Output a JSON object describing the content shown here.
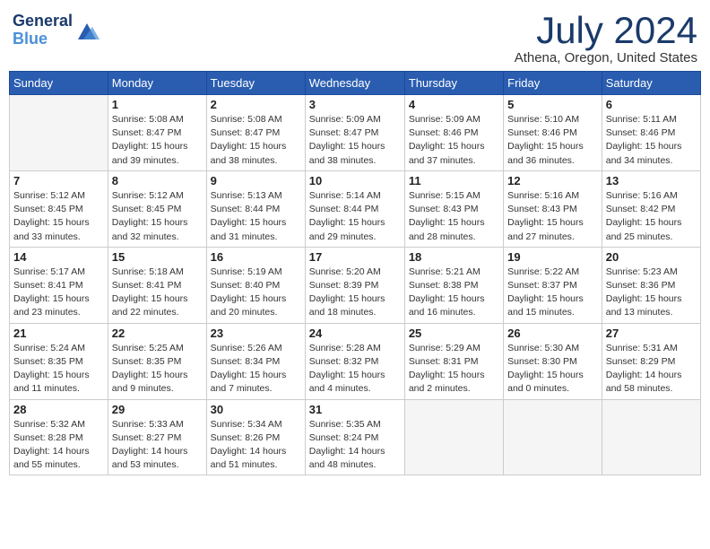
{
  "header": {
    "logo_line1": "General",
    "logo_line2": "Blue",
    "month_title": "July 2024",
    "location": "Athena, Oregon, United States"
  },
  "weekdays": [
    "Sunday",
    "Monday",
    "Tuesday",
    "Wednesday",
    "Thursday",
    "Friday",
    "Saturday"
  ],
  "weeks": [
    [
      {
        "day": "",
        "sunrise": "",
        "sunset": "",
        "daylight": "",
        "empty": true
      },
      {
        "day": "1",
        "sunrise": "5:08 AM",
        "sunset": "8:47 PM",
        "daylight": "15 hours and 39 minutes."
      },
      {
        "day": "2",
        "sunrise": "5:08 AM",
        "sunset": "8:47 PM",
        "daylight": "15 hours and 38 minutes."
      },
      {
        "day": "3",
        "sunrise": "5:09 AM",
        "sunset": "8:47 PM",
        "daylight": "15 hours and 38 minutes."
      },
      {
        "day": "4",
        "sunrise": "5:09 AM",
        "sunset": "8:46 PM",
        "daylight": "15 hours and 37 minutes."
      },
      {
        "day": "5",
        "sunrise": "5:10 AM",
        "sunset": "8:46 PM",
        "daylight": "15 hours and 36 minutes."
      },
      {
        "day": "6",
        "sunrise": "5:11 AM",
        "sunset": "8:46 PM",
        "daylight": "15 hours and 34 minutes."
      }
    ],
    [
      {
        "day": "7",
        "sunrise": "5:12 AM",
        "sunset": "8:45 PM",
        "daylight": "15 hours and 33 minutes."
      },
      {
        "day": "8",
        "sunrise": "5:12 AM",
        "sunset": "8:45 PM",
        "daylight": "15 hours and 32 minutes."
      },
      {
        "day": "9",
        "sunrise": "5:13 AM",
        "sunset": "8:44 PM",
        "daylight": "15 hours and 31 minutes."
      },
      {
        "day": "10",
        "sunrise": "5:14 AM",
        "sunset": "8:44 PM",
        "daylight": "15 hours and 29 minutes."
      },
      {
        "day": "11",
        "sunrise": "5:15 AM",
        "sunset": "8:43 PM",
        "daylight": "15 hours and 28 minutes."
      },
      {
        "day": "12",
        "sunrise": "5:16 AM",
        "sunset": "8:43 PM",
        "daylight": "15 hours and 27 minutes."
      },
      {
        "day": "13",
        "sunrise": "5:16 AM",
        "sunset": "8:42 PM",
        "daylight": "15 hours and 25 minutes."
      }
    ],
    [
      {
        "day": "14",
        "sunrise": "5:17 AM",
        "sunset": "8:41 PM",
        "daylight": "15 hours and 23 minutes."
      },
      {
        "day": "15",
        "sunrise": "5:18 AM",
        "sunset": "8:41 PM",
        "daylight": "15 hours and 22 minutes."
      },
      {
        "day": "16",
        "sunrise": "5:19 AM",
        "sunset": "8:40 PM",
        "daylight": "15 hours and 20 minutes."
      },
      {
        "day": "17",
        "sunrise": "5:20 AM",
        "sunset": "8:39 PM",
        "daylight": "15 hours and 18 minutes."
      },
      {
        "day": "18",
        "sunrise": "5:21 AM",
        "sunset": "8:38 PM",
        "daylight": "15 hours and 16 minutes."
      },
      {
        "day": "19",
        "sunrise": "5:22 AM",
        "sunset": "8:37 PM",
        "daylight": "15 hours and 15 minutes."
      },
      {
        "day": "20",
        "sunrise": "5:23 AM",
        "sunset": "8:36 PM",
        "daylight": "15 hours and 13 minutes."
      }
    ],
    [
      {
        "day": "21",
        "sunrise": "5:24 AM",
        "sunset": "8:35 PM",
        "daylight": "15 hours and 11 minutes."
      },
      {
        "day": "22",
        "sunrise": "5:25 AM",
        "sunset": "8:35 PM",
        "daylight": "15 hours and 9 minutes."
      },
      {
        "day": "23",
        "sunrise": "5:26 AM",
        "sunset": "8:34 PM",
        "daylight": "15 hours and 7 minutes."
      },
      {
        "day": "24",
        "sunrise": "5:28 AM",
        "sunset": "8:32 PM",
        "daylight": "15 hours and 4 minutes."
      },
      {
        "day": "25",
        "sunrise": "5:29 AM",
        "sunset": "8:31 PM",
        "daylight": "15 hours and 2 minutes."
      },
      {
        "day": "26",
        "sunrise": "5:30 AM",
        "sunset": "8:30 PM",
        "daylight": "15 hours and 0 minutes."
      },
      {
        "day": "27",
        "sunrise": "5:31 AM",
        "sunset": "8:29 PM",
        "daylight": "14 hours and 58 minutes."
      }
    ],
    [
      {
        "day": "28",
        "sunrise": "5:32 AM",
        "sunset": "8:28 PM",
        "daylight": "14 hours and 55 minutes."
      },
      {
        "day": "29",
        "sunrise": "5:33 AM",
        "sunset": "8:27 PM",
        "daylight": "14 hours and 53 minutes."
      },
      {
        "day": "30",
        "sunrise": "5:34 AM",
        "sunset": "8:26 PM",
        "daylight": "14 hours and 51 minutes."
      },
      {
        "day": "31",
        "sunrise": "5:35 AM",
        "sunset": "8:24 PM",
        "daylight": "14 hours and 48 minutes."
      },
      {
        "day": "",
        "sunrise": "",
        "sunset": "",
        "daylight": "",
        "empty": true
      },
      {
        "day": "",
        "sunrise": "",
        "sunset": "",
        "daylight": "",
        "empty": true
      },
      {
        "day": "",
        "sunrise": "",
        "sunset": "",
        "daylight": "",
        "empty": true
      }
    ]
  ]
}
